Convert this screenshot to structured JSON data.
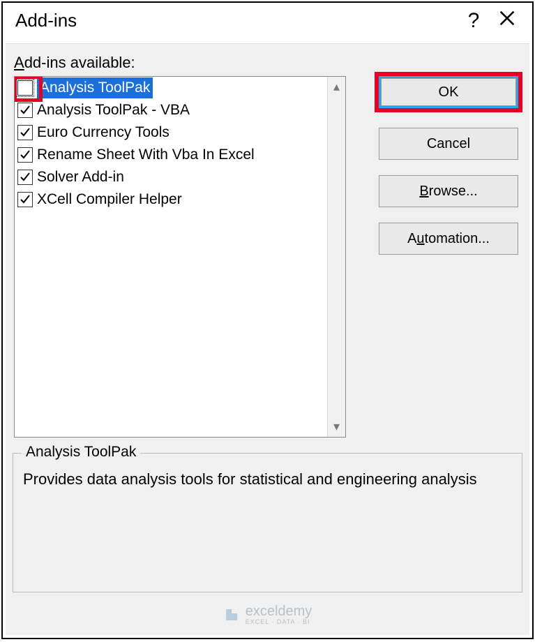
{
  "dialog": {
    "title": "Add-ins",
    "listLabelPrefix": "A",
    "listLabelRest": "dd-ins available:"
  },
  "addins": {
    "items": [
      {
        "label": "Analysis ToolPak",
        "checked": false,
        "selected": true
      },
      {
        "label": "Analysis ToolPak - VBA",
        "checked": true,
        "selected": false
      },
      {
        "label": "Euro Currency Tools",
        "checked": true,
        "selected": false
      },
      {
        "label": "Rename Sheet With Vba In Excel",
        "checked": true,
        "selected": false
      },
      {
        "label": "Solver Add-in",
        "checked": true,
        "selected": false
      },
      {
        "label": "XCell Compiler Helper",
        "checked": true,
        "selected": false
      }
    ]
  },
  "buttons": {
    "ok": "OK",
    "cancel": "Cancel",
    "browse_pre": "B",
    "browse_post": "rowse...",
    "automation_pre": "A",
    "automation_mid": "u",
    "automation_post": "tomation..."
  },
  "description": {
    "title": "Analysis ToolPak",
    "text": "Provides data analysis tools for statistical and engineering analysis"
  },
  "watermark": {
    "name": "exceldemy",
    "tagline": "EXCEL · DATA · BI"
  }
}
